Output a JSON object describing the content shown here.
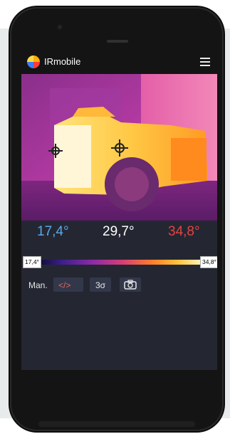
{
  "app": {
    "title": "IRmobile",
    "icons": {
      "logo": "irmobile-logo-icon",
      "menu": "hamburger-menu-icon"
    }
  },
  "temperatures": {
    "min": "17,4°",
    "center": "29,7°",
    "max": "34,8°"
  },
  "scale": {
    "min_label": "17,4°",
    "max_label": "34,8°"
  },
  "toolbar": {
    "mode": "Man.",
    "code": "</>",
    "sigma": "3σ",
    "camera_icon": "camera-icon"
  },
  "colors": {
    "min_temp": "#5aa9e6",
    "center_temp": "#ffffff",
    "max_temp": "#e34343"
  }
}
